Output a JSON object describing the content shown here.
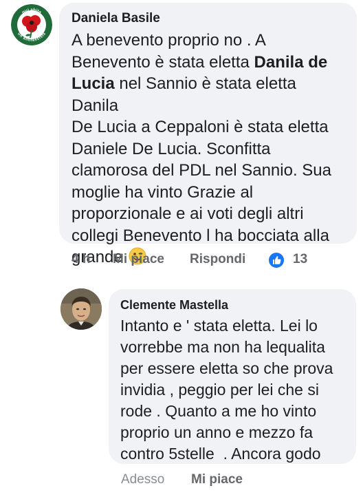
{
  "comment": {
    "author": "Daniela Basile",
    "avatar_text_top": "qui abita",
    "avatar_text_bottom": "un antifascista",
    "body_lines": [
      "A benevento proprio no . A",
      "Benevento è stata eletta",
      "Danila de",
      "Lucia",
      "nel Sannio è stata eletta Danila",
      "De Lucia a Ceppaloni è stata eletta",
      "Daniele De Lucia. Sconfitta",
      "clamorosa del PDL nel Sannio. Sua",
      "moglie ha vinto Grazie al",
      "proporzionale e ai voti degli altri",
      "collegi Benevento l ha bocciata alla",
      "grande"
    ],
    "emoji": "wink-emoji",
    "time": "4 h",
    "like_label": "Mi piace",
    "reply_label": "Rispondi",
    "reaction_icon": "like-thumb-icon",
    "reaction_count": "13"
  },
  "reply": {
    "author": "Clemente Mastella",
    "body_lines": [
      "Intanto e ' stata eletta. Lei lo",
      "vorrebbe ma non ha lequalita",
      "per essere eletta so che prova",
      "invidia , peggio per lei che si",
      "rode . Quanto a me ho vinto",
      "proprio un anno e mezzo fa",
      "contro 5stelle  . Ancora godo"
    ],
    "time": "Adesso",
    "like_label": "Mi piace"
  },
  "colors": {
    "bubble": "#f0f2f5",
    "text": "#1c1e21",
    "meta": "#65676b",
    "like_blue": "#1877f2",
    "avatar_green": "#1f6b3a",
    "poppy_red": "#d0151b"
  }
}
